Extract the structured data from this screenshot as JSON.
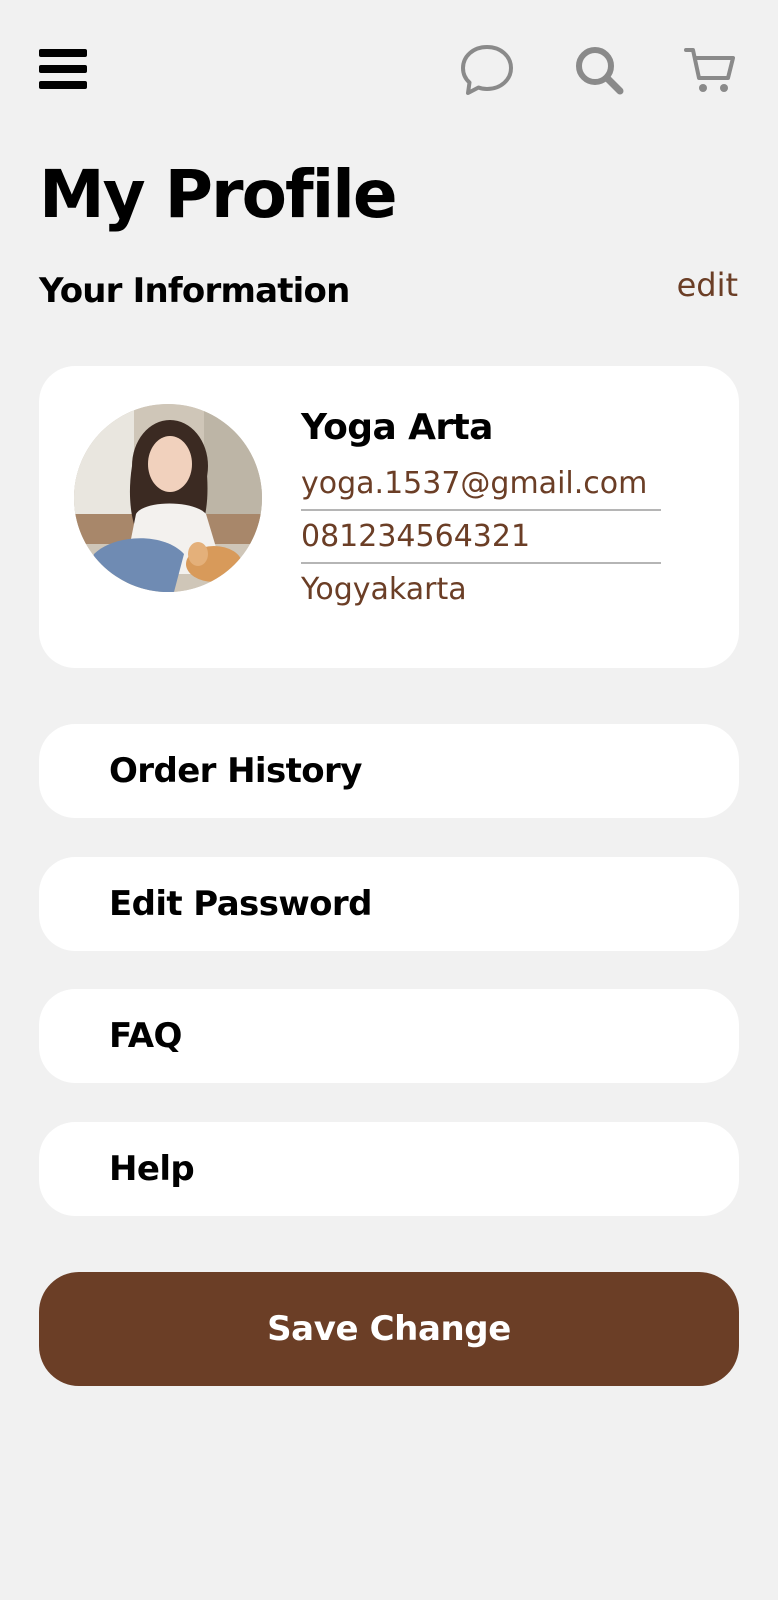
{
  "header": {
    "icons": [
      "menu-icon",
      "chat-icon",
      "search-icon",
      "cart-icon"
    ]
  },
  "page": {
    "title": "My Profile",
    "section_title": "Your Information",
    "edit_label": "edit"
  },
  "profile": {
    "name": "Yoga Arta",
    "email": "yoga.1537@gmail.com",
    "phone": "081234564321",
    "city": "Yogyakarta"
  },
  "menu": [
    {
      "label": "Order History"
    },
    {
      "label": "Edit Password"
    },
    {
      "label": "FAQ"
    },
    {
      "label": "Help"
    }
  ],
  "actions": {
    "save_label": "Save Change"
  },
  "colors": {
    "background": "#f1f1f1",
    "card": "#ffffff",
    "accent_brown": "#6b3e26",
    "icon_gray": "#8a8a8a",
    "text_primary": "#000000"
  }
}
